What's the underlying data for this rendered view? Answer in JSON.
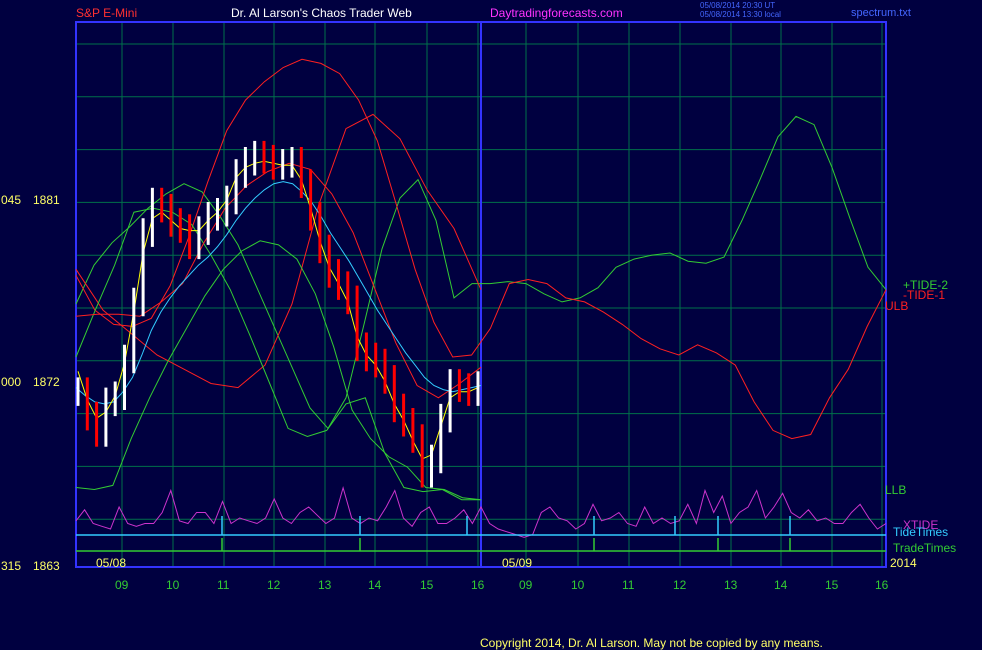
{
  "header": {
    "instrument": "S&P E-Mini",
    "site_title": "Dr. Al Larson's Chaos Trader Web",
    "site_url": "Daytradingforecasts.com",
    "timestamp_line1": "05/08/2014 20:30 UT",
    "timestamp_line2": "05/08/2014 13:30 local",
    "file_name": "spectrum.txt"
  },
  "footer": {
    "copyright": "Copyright 2014, Dr. Al Larson. May not be copied by any means."
  },
  "colors": {
    "background": "#000040",
    "frame": "#3333ff",
    "grid": "#00704a",
    "price_up": "#ffffff",
    "price_down": "#ff0000",
    "tide_2": "#33cc33",
    "tide_1": "#ff2020",
    "moving_avg_fast": "#ffff00",
    "moving_avg_slow": "#33ccff",
    "xtide": "#cc33cc",
    "tide_times": "#33ccff",
    "trade_times": "#33cc33"
  },
  "chart_data": {
    "type": "line",
    "title": "S&P E-Mini",
    "y_axis": {
      "ticks": [
        {
          "left_label": "045",
          "value": 1881
        },
        {
          "left_label": "000",
          "value": 1872
        },
        {
          "left_label": "315",
          "value": 1863
        }
      ],
      "ylim": [
        1863,
        1881
      ]
    },
    "x_axis": {
      "hour_ticks_day1": [
        "09",
        "10",
        "11",
        "12",
        "13",
        "14",
        "15",
        "16"
      ],
      "hour_ticks_day2": [
        "09",
        "10",
        "11",
        "12",
        "13",
        "14",
        "15",
        "16"
      ],
      "day_labels": [
        "05/08",
        "05/09"
      ],
      "year_label": "2014"
    },
    "grid": true,
    "series_labels": {
      "tide_2": "+TIDE-2",
      "tide_1": "-TIDE-1",
      "upper_band": "ULB",
      "lower_band": "LLB",
      "xtide": "XTIDE",
      "tide_times": "TideTimes",
      "trade_times": "TradeTimes"
    },
    "price_close": [
      1871.6,
      1870.4,
      1869.6,
      1871.1,
      1871.4,
      1873.2,
      1876.0,
      1879.4,
      1880.9,
      1880.6,
      1879.9,
      1879.6,
      1878.8,
      1879.5,
      1880.2,
      1880.4,
      1881.0,
      1882.3,
      1882.9,
      1883.2,
      1883.0,
      1882.7,
      1882.8,
      1882.9,
      1881.8,
      1880.2,
      1878.6,
      1877.4,
      1876.8,
      1876.1,
      1873.8,
      1873.3,
      1873.0,
      1872.2,
      1870.8,
      1870.1,
      1869.3,
      1867.6,
      1868.3,
      1870.3,
      1872.0,
      1871.8,
      1871.6,
      1871.9
    ],
    "price_ma_fast": [
      1872.6,
      1871.2,
      1870.3,
      1870.6,
      1871.4,
      1873.0,
      1875.5,
      1878.4,
      1880.1,
      1880.4,
      1880.0,
      1879.6,
      1879.5,
      1879.5,
      1880.0,
      1880.4,
      1881.0,
      1882.1,
      1882.6,
      1882.8,
      1882.9,
      1882.8,
      1882.7,
      1882.7,
      1882.0,
      1880.6,
      1879.0,
      1877.7,
      1876.9,
      1876.0,
      1874.3,
      1873.4,
      1872.9,
      1872.1,
      1871.0,
      1870.2,
      1869.2,
      1868.3,
      1868.5,
      1869.9,
      1871.3,
      1871.6,
      1871.6,
      1871.8
    ],
    "price_ma_slow": [
      1871.8,
      1871.4,
      1871.1,
      1871.0,
      1871.1,
      1871.6,
      1872.3,
      1873.4,
      1874.6,
      1875.5,
      1876.2,
      1876.8,
      1877.3,
      1877.8,
      1878.2,
      1878.7,
      1879.3,
      1880.0,
      1880.6,
      1881.1,
      1881.5,
      1881.8,
      1881.9,
      1881.8,
      1881.4,
      1880.9,
      1880.2,
      1879.4,
      1878.7,
      1878.0,
      1877.2,
      1876.4,
      1875.6,
      1874.9,
      1874.2,
      1873.5,
      1872.9,
      1872.3,
      1871.9,
      1871.7,
      1871.6,
      1871.7,
      1871.8,
      1871.9
    ],
    "tide_2": [
      1875.9,
      1877.8,
      1878.9,
      1879.7,
      1880.6,
      1881.3,
      1881.8,
      1881.4,
      1880.2,
      1878.8,
      1876.8,
      1874.8,
      1872.8,
      1870.8,
      1869.8,
      1871.3,
      1874.9,
      1878.6,
      1881.1,
      1882.0,
      1880.0,
      1876.2,
      1876.9,
      1876.9,
      1877.0,
      1876.9,
      1876.4,
      1876.0,
      1876.2,
      1876.7,
      1877.7,
      1878.1,
      1878.3,
      1878.4,
      1878.0,
      1877.9,
      1878.2,
      1880.0,
      1882.0,
      1884.1,
      1885.1,
      1884.7,
      1882.6,
      1880.1,
      1877.7,
      1876.6
    ],
    "tide_1": [
      1877.3,
      1875.6,
      1874.9,
      1874.8,
      1875.2,
      1876.8,
      1879.2,
      1881.9,
      1884.4,
      1885.9,
      1886.8,
      1887.5,
      1887.9,
      1887.7,
      1887.2,
      1885.9,
      1883.9,
      1880.8,
      1877.6,
      1875.0,
      1873.3,
      1873.4,
      1874.7,
      1876.9,
      1877.1,
      1876.9,
      1876.2,
      1876.0,
      1875.5,
      1874.9,
      1874.2,
      1873.7,
      1873.4,
      1873.9,
      1873.5,
      1872.9,
      1871.1,
      1869.7,
      1869.3,
      1869.5,
      1871.3,
      1872.7,
      1874.8,
      1876.6
    ],
    "upper_band_short": [
      1877.6,
      1875.6,
      1874.5,
      1873.4,
      1872.7,
      1872.0,
      1871.8,
      1872.9,
      1875.9,
      1880.8,
      1884.5,
      1885.2,
      1884.0,
      1881.5,
      1879.6,
      1876.6
    ],
    "lower_band_short": [
      1873.3,
      1875.6,
      1877.8,
      1880.4,
      1880.6,
      1880.4,
      1879.8,
      1878.3,
      1876.6,
      1874.4,
      1872.1,
      1869.8,
      1869.4,
      1869.7,
      1871.0,
      1871.3,
      1868.6,
      1866.9,
      1866.7,
      1866.8,
      1866.3,
      1866.3
    ],
    "hump_green": [
      1866.9,
      1866.8,
      1867.0,
      1869.3,
      1871.3,
      1873.1,
      1874.7,
      1876.3,
      1877.6,
      1878.5,
      1879.0,
      1878.8,
      1878.1,
      1876.4,
      1873.8,
      1870.7,
      1869.3,
      1868.4,
      1867.9,
      1866.9,
      1866.8,
      1866.4,
      1866.3
    ],
    "hump_red": [
      1875.3,
      1875.4,
      1875.4,
      1875.3,
      1876.0,
      1876.9,
      1878.9,
      1880.6,
      1881.7,
      1882.4,
      1882.8,
      1882.5,
      1881.3,
      1879.4,
      1876.7,
      1874.0,
      1871.9,
      1871.3,
      1872.0,
      1872.8
    ],
    "xtide": [
      0.35,
      0.55,
      0.3,
      0.25,
      0.2,
      0.6,
      0.3,
      0.25,
      0.3,
      0.3,
      0.5,
      0.9,
      0.35,
      0.3,
      0.5,
      0.5,
      0.3,
      0.7,
      0.3,
      0.4,
      0.35,
      0.3,
      0.4,
      0.75,
      0.4,
      0.3,
      0.5,
      0.6,
      0.45,
      0.3,
      0.4,
      0.95,
      0.4,
      0.3,
      0.4,
      0.35,
      0.6,
      0.9,
      0.4,
      0.25,
      0.5,
      0.6,
      0.3,
      0.3,
      0.4,
      0.55,
      0.3,
      0.6,
      0.3,
      0.2,
      0.15,
      0.1,
      0.05,
      0.1,
      0.5,
      0.6,
      0.4,
      0.35,
      0.2,
      0.3,
      0.65,
      0.35,
      0.4,
      0.5,
      0.3,
      0.25,
      0.6,
      0.3,
      0.4,
      0.3,
      0.35,
      0.65,
      0.3,
      0.9,
      0.5,
      0.8,
      0.3,
      0.5,
      0.6,
      0.9,
      0.4,
      0.6,
      0.85,
      0.5,
      0.4,
      0.55,
      0.35,
      0.4,
      0.3,
      0.3,
      0.5,
      0.65,
      0.4,
      0.2,
      0.3
    ]
  }
}
